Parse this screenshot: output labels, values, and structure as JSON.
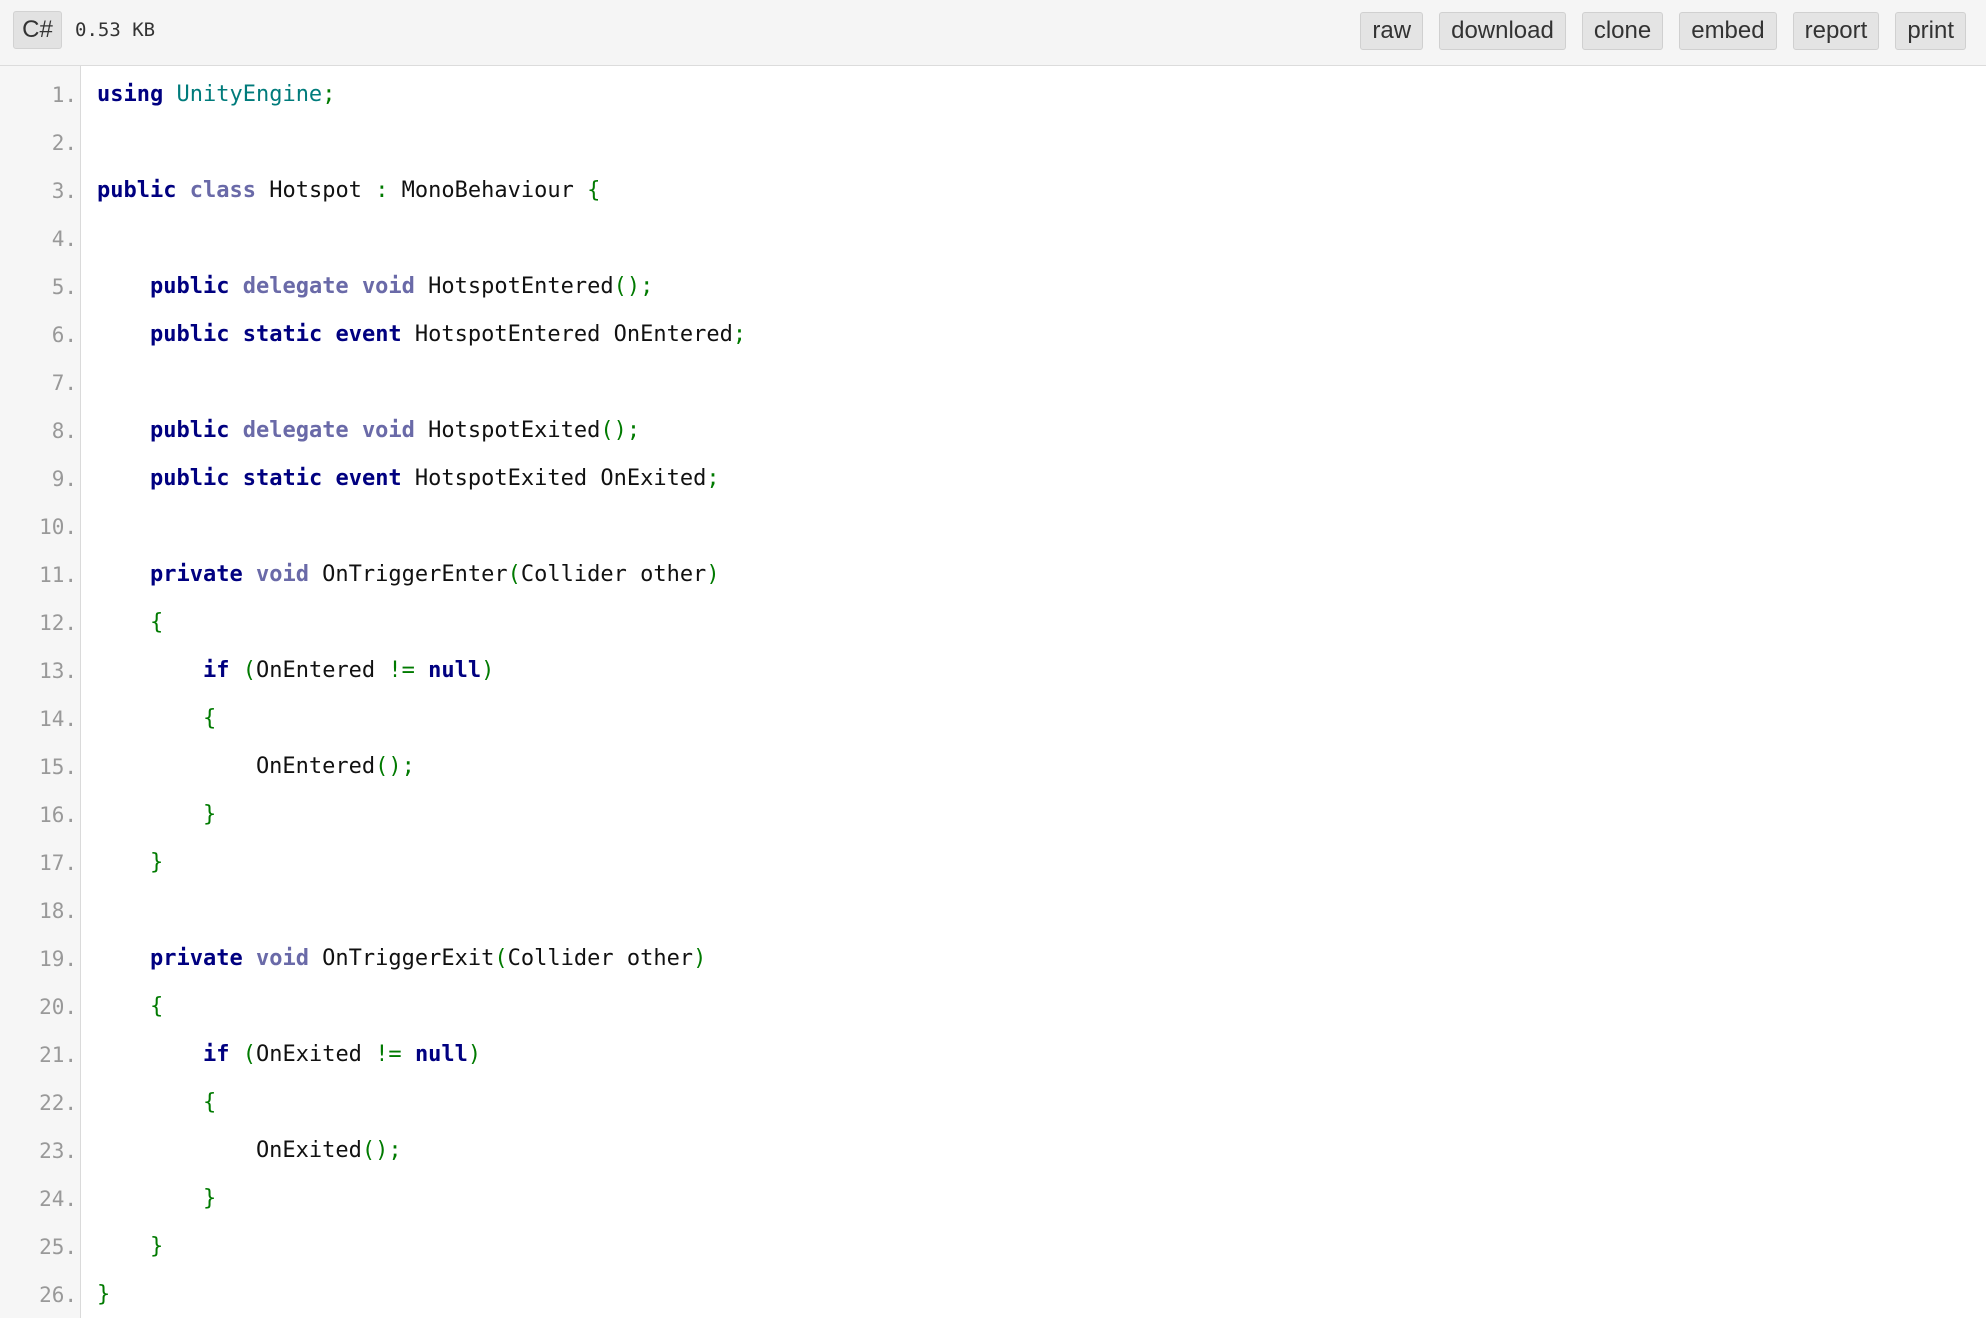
{
  "toolbar": {
    "language": "C#",
    "size": "0.53 KB",
    "buttons": [
      "raw",
      "download",
      "clone",
      "embed",
      "report",
      "print"
    ]
  },
  "code": {
    "lines": [
      [
        [
          "kw",
          "using"
        ],
        [
          "t",
          " "
        ],
        [
          "ns",
          "UnityEngine"
        ],
        [
          "pn",
          ";"
        ]
      ],
      [],
      [
        [
          "kw",
          "public"
        ],
        [
          "t",
          " "
        ],
        [
          "kw2",
          "class"
        ],
        [
          "t",
          " Hotspot "
        ],
        [
          "pn",
          ":"
        ],
        [
          "t",
          " MonoBehaviour "
        ],
        [
          "pn",
          "{"
        ]
      ],
      [],
      [
        [
          "t",
          "    "
        ],
        [
          "kw",
          "public"
        ],
        [
          "t",
          " "
        ],
        [
          "kw2",
          "delegate"
        ],
        [
          "t",
          " "
        ],
        [
          "kw2",
          "void"
        ],
        [
          "t",
          " HotspotEntered"
        ],
        [
          "pn",
          "();"
        ]
      ],
      [
        [
          "t",
          "    "
        ],
        [
          "kw",
          "public"
        ],
        [
          "t",
          " "
        ],
        [
          "kw",
          "static"
        ],
        [
          "t",
          " "
        ],
        [
          "kw",
          "event"
        ],
        [
          "t",
          " HotspotEntered OnEntered"
        ],
        [
          "pn",
          ";"
        ]
      ],
      [],
      [
        [
          "t",
          "    "
        ],
        [
          "kw",
          "public"
        ],
        [
          "t",
          " "
        ],
        [
          "kw2",
          "delegate"
        ],
        [
          "t",
          " "
        ],
        [
          "kw2",
          "void"
        ],
        [
          "t",
          " HotspotExited"
        ],
        [
          "pn",
          "();"
        ]
      ],
      [
        [
          "t",
          "    "
        ],
        [
          "kw",
          "public"
        ],
        [
          "t",
          " "
        ],
        [
          "kw",
          "static"
        ],
        [
          "t",
          " "
        ],
        [
          "kw",
          "event"
        ],
        [
          "t",
          " HotspotExited OnExited"
        ],
        [
          "pn",
          ";"
        ]
      ],
      [],
      [
        [
          "t",
          "    "
        ],
        [
          "kw",
          "private"
        ],
        [
          "t",
          " "
        ],
        [
          "kw2",
          "void"
        ],
        [
          "t",
          " OnTriggerEnter"
        ],
        [
          "pn",
          "("
        ],
        [
          "t",
          "Collider other"
        ],
        [
          "pn",
          ")"
        ]
      ],
      [
        [
          "t",
          "    "
        ],
        [
          "pn",
          "{"
        ]
      ],
      [
        [
          "t",
          "        "
        ],
        [
          "kw",
          "if"
        ],
        [
          "t",
          " "
        ],
        [
          "pn",
          "("
        ],
        [
          "t",
          "OnEntered "
        ],
        [
          "pn",
          "!="
        ],
        [
          "t",
          " "
        ],
        [
          "kw",
          "null"
        ],
        [
          "pn",
          ")"
        ]
      ],
      [
        [
          "t",
          "        "
        ],
        [
          "pn",
          "{"
        ]
      ],
      [
        [
          "t",
          "            OnEntered"
        ],
        [
          "pn",
          "();"
        ]
      ],
      [
        [
          "t",
          "        "
        ],
        [
          "pn",
          "}"
        ]
      ],
      [
        [
          "t",
          "    "
        ],
        [
          "pn",
          "}"
        ]
      ],
      [],
      [
        [
          "t",
          "    "
        ],
        [
          "kw",
          "private"
        ],
        [
          "t",
          " "
        ],
        [
          "kw2",
          "void"
        ],
        [
          "t",
          " OnTriggerExit"
        ],
        [
          "pn",
          "("
        ],
        [
          "t",
          "Collider other"
        ],
        [
          "pn",
          ")"
        ]
      ],
      [
        [
          "t",
          "    "
        ],
        [
          "pn",
          "{"
        ]
      ],
      [
        [
          "t",
          "        "
        ],
        [
          "kw",
          "if"
        ],
        [
          "t",
          " "
        ],
        [
          "pn",
          "("
        ],
        [
          "t",
          "OnExited "
        ],
        [
          "pn",
          "!="
        ],
        [
          "t",
          " "
        ],
        [
          "kw",
          "null"
        ],
        [
          "pn",
          ")"
        ]
      ],
      [
        [
          "t",
          "        "
        ],
        [
          "pn",
          "{"
        ]
      ],
      [
        [
          "t",
          "            OnExited"
        ],
        [
          "pn",
          "();"
        ]
      ],
      [
        [
          "t",
          "        "
        ],
        [
          "pn",
          "}"
        ]
      ],
      [
        [
          "t",
          "    "
        ],
        [
          "pn",
          "}"
        ]
      ],
      [
        [
          "pn",
          "}"
        ]
      ]
    ]
  }
}
